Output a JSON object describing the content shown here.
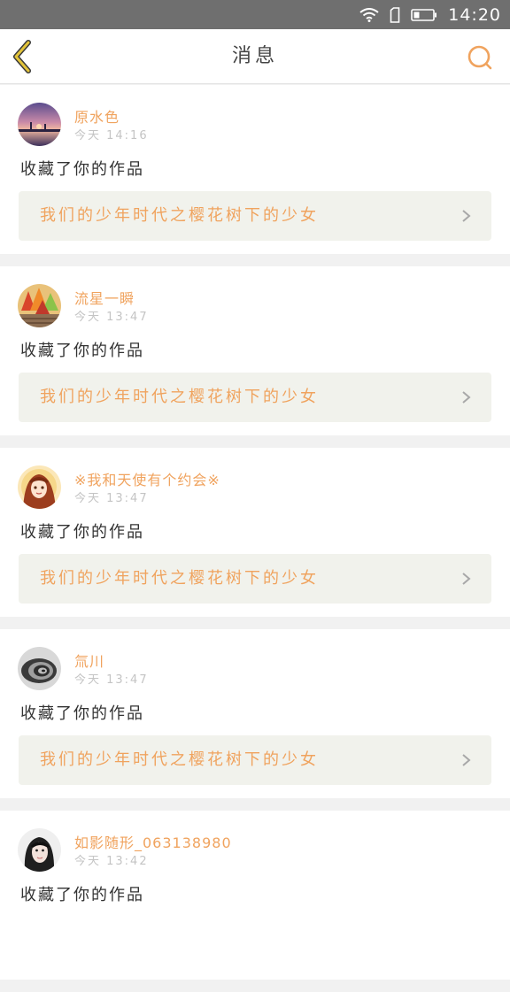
{
  "status_bar": {
    "time": "14:20",
    "icons": [
      "wifi-icon",
      "sim-icon",
      "battery-icon"
    ]
  },
  "nav": {
    "title": "消息",
    "back_icon": "back-chevron-icon",
    "search_icon": "search-icon"
  },
  "colors": {
    "accent": "#f0a35e",
    "back": "#d8b82e",
    "status_bar": "#6f6f6f",
    "card_link_bg": "#f1f2ec"
  },
  "messages": [
    {
      "username": "原水色",
      "time": "今天 14:16",
      "action": "收藏了你的作品",
      "work_title": "我们的少年时代之樱花树下的少女",
      "avatar": "sunset-avatar"
    },
    {
      "username": "流星一瞬",
      "time": "今天 13:47",
      "action": "收藏了你的作品",
      "work_title": "我们的少年时代之樱花树下的少女",
      "avatar": "autumn-leaves-avatar"
    },
    {
      "username": "※我和天使有个约会※",
      "time": "今天 13:47",
      "action": "收藏了你的作品",
      "work_title": "我们的少年时代之樱花树下的少女",
      "avatar": "anime-girl-avatar"
    },
    {
      "username": "氚川",
      "time": "今天 13:47",
      "action": "收藏了你的作品",
      "work_title": "我们的少年时代之樱花树下的少女",
      "avatar": "spiral-avatar"
    },
    {
      "username": "如影随形_063138980",
      "time": "今天 13:42",
      "action": "收藏了你的作品",
      "work_title": "",
      "avatar": "girl-photo-avatar"
    }
  ]
}
